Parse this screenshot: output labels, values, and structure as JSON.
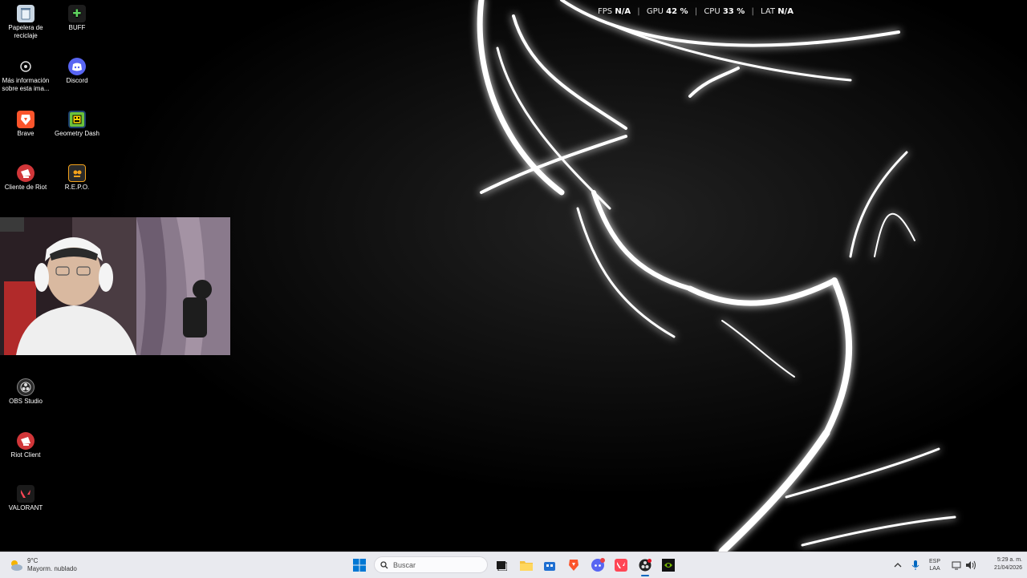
{
  "overlay": {
    "fps_label": "FPS",
    "fps_value": "N/A",
    "gpu_label": "GPU",
    "gpu_value": "42 %",
    "cpu_label": "CPU",
    "cpu_value": "33 %",
    "lat_label": "LAT",
    "lat_value": "N/A"
  },
  "desktop": {
    "icons": [
      {
        "label": "Papelera de reciclaje",
        "icon": "recycle-bin-icon"
      },
      {
        "label": "BUFF",
        "icon": "buff-icon"
      },
      {
        "label": "Más información sobre esta ima...",
        "icon": "info-camera-icon"
      },
      {
        "label": "Discord",
        "icon": "discord-icon"
      },
      {
        "label": "Brave",
        "icon": "brave-icon"
      },
      {
        "label": "Geometry Dash",
        "icon": "geometry-dash-icon"
      },
      {
        "label": "Cliente de Riot",
        "icon": "riot-client-icon"
      },
      {
        "label": "R.E.P.O.",
        "icon": "repo-icon"
      },
      {
        "label": "OBS Studio",
        "icon": "obs-icon"
      },
      {
        "label": "Riot Client",
        "icon": "riot-client-icon"
      },
      {
        "label": "VALORANT",
        "icon": "valorant-icon"
      }
    ]
  },
  "taskbar": {
    "weather": {
      "temp": "9°C",
      "condition": "Mayorm. nublado"
    },
    "search_placeholder": "Buscar",
    "apps": [
      "task-view-icon",
      "file-explorer-icon",
      "store-icon",
      "brave-icon",
      "discord-icon",
      "valorant-icon",
      "obs-icon",
      "nvidia-icon"
    ],
    "tray": {
      "lang_top": "ESP",
      "lang_bottom": "LAA"
    },
    "clock": {
      "time": "5:29 a. m.",
      "date": "21/04/2026"
    }
  },
  "colors": {
    "taskbar_bg": "#e9eaef",
    "accent": "#0067c0",
    "riot_red": "#d13639",
    "discord": "#5865f2"
  }
}
